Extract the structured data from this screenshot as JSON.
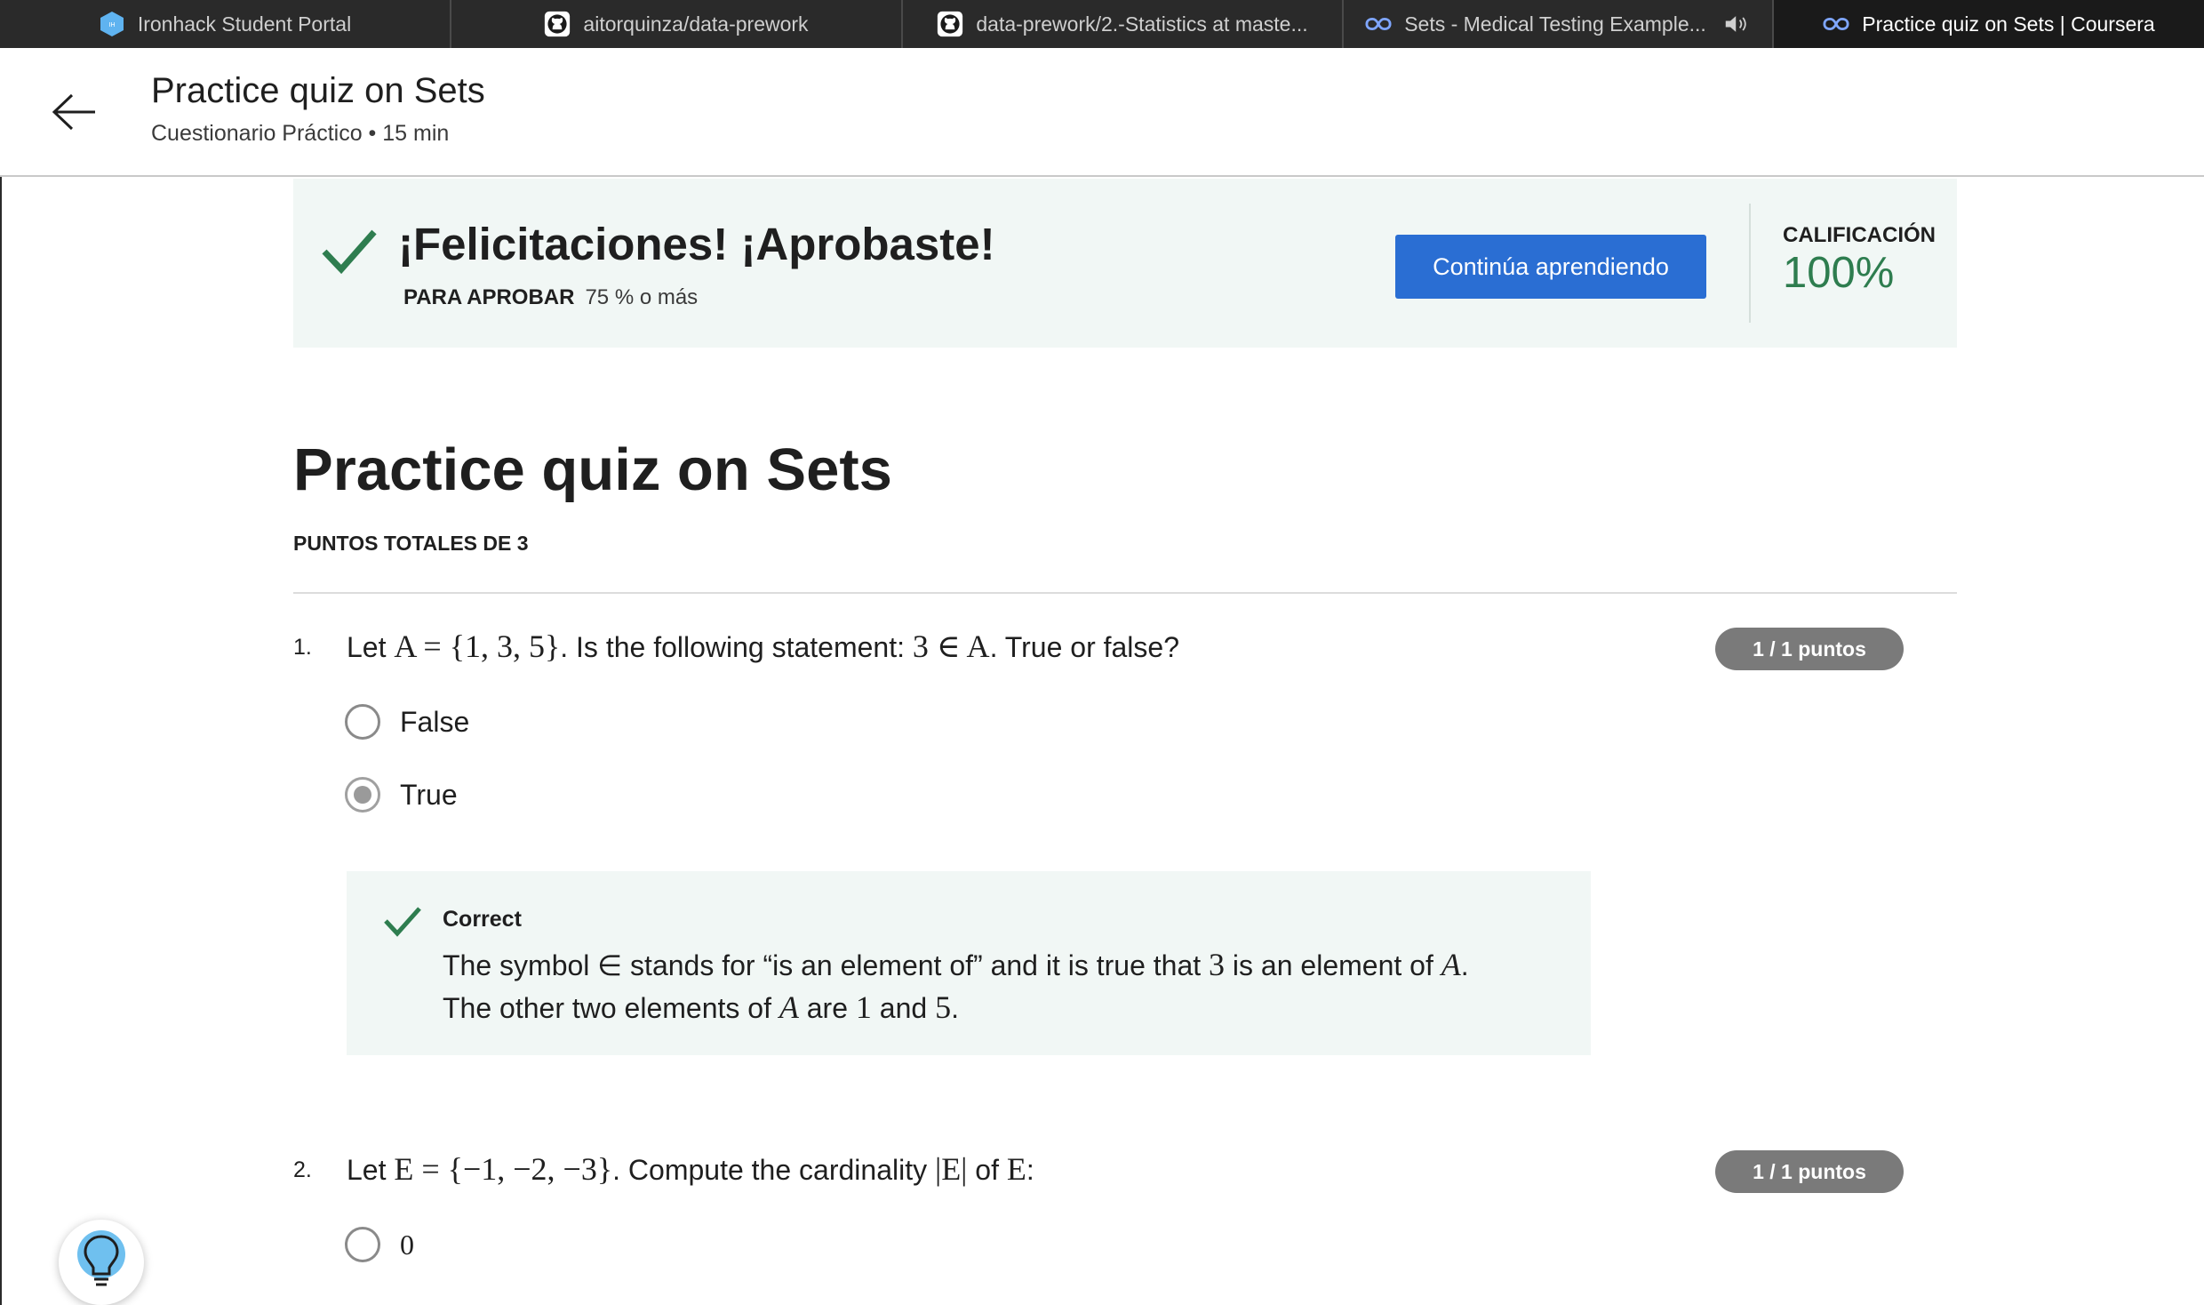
{
  "browser": {
    "tabs": [
      {
        "title": "Ironhack Student Portal",
        "icon": "ironhack-icon",
        "active": false
      },
      {
        "title": "aitorquinza/data-prework",
        "icon": "github-icon",
        "active": false
      },
      {
        "title": "data-prework/2.-Statistics at maste...",
        "icon": "github-icon",
        "active": false
      },
      {
        "title": "Sets - Medical Testing Example...",
        "icon": "coursera-icon",
        "active": false,
        "speaker": "speaker-icon"
      },
      {
        "title": "Practice quiz on Sets | Coursera",
        "icon": "coursera-icon",
        "active": true
      }
    ]
  },
  "header": {
    "title": "Practice quiz on Sets",
    "subtitle": "Cuestionario Práctico • 15 min"
  },
  "banner": {
    "title": "¡Felicitaciones! ¡Aprobaste!",
    "pass_label": "PARA APROBAR",
    "pass_value": "75 % o más",
    "continue_label": "Continúa aprendiendo",
    "grade_label": "CALIFICACIÓN",
    "grade_value": "100%",
    "accent_color": "#2e7d4f",
    "button_color": "#2a6ed3"
  },
  "quiz": {
    "title": "Practice quiz on Sets",
    "total_points": "PUNTOS TOTALES DE 3",
    "questions": [
      {
        "number": "1.",
        "text_before": "Let ",
        "math_1": "A = {1, 3, 5}",
        "text_mid": ". Is the following statement: ",
        "math_2": "3 ∈ A",
        "text_after": ". True or false?",
        "points": "1 / 1 puntos",
        "options": [
          {
            "label": "False",
            "selected": false
          },
          {
            "label": "True",
            "selected": true
          }
        ],
        "feedback": {
          "title": "Correct",
          "line1_a": "The symbol ∈ stands for “is an element of” and it is true that ",
          "line1_m1": "3",
          "line1_b": " is an element of ",
          "line1_m2": "A",
          "line1_c": ".",
          "line2_a": "The other two elements of ",
          "line2_m1": "A",
          "line2_b": " are ",
          "line2_m2": "1",
          "line2_c": " and ",
          "line2_m3": "5",
          "line2_d": "."
        }
      },
      {
        "number": "2.",
        "text_before": "Let ",
        "math_1": "E = {−1, −2, −3}",
        "text_mid": ". Compute the cardinality ",
        "math_2": "|E|",
        "text_mid2": " of ",
        "math_3": "E",
        "text_after": ":",
        "points": "1 / 1 puntos",
        "options": [
          {
            "label": "0",
            "selected": false
          }
        ]
      }
    ]
  },
  "helper": {
    "icon": "lightbulb-icon"
  }
}
